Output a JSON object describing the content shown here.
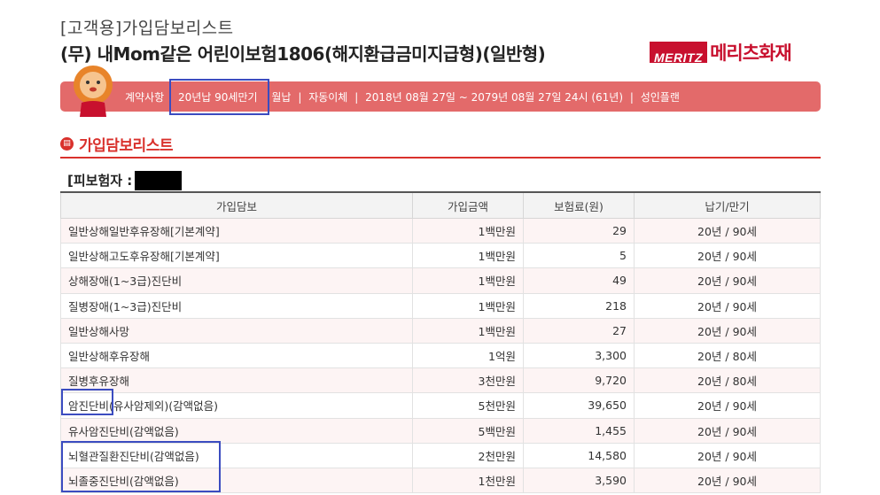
{
  "header": {
    "subtitle": "[고객용]가입담보리스트",
    "title": "(무) 내Mom같은 어린이보험1806(해지환급금미지급형)(일반형)"
  },
  "brand": {
    "mark": "MERITZ",
    "name": "메리츠화재",
    "color": "#c8102e"
  },
  "banner": {
    "label": "계약사항",
    "term": "20년납 90세만기",
    "payment": "월납",
    "transfer": "자동이체",
    "period": "2018년 08월 27일 ~ 2079년 08월 27일 24시 (61년)",
    "plan": "성인플랜",
    "separator": "|",
    "color": "#e36a6a"
  },
  "section": {
    "title": "가입담보리스트"
  },
  "insured": {
    "label": "[피보험자 :"
  },
  "table": {
    "headers": [
      "가입담보",
      "가입금액",
      "보험료(원)",
      "납기/만기"
    ],
    "rows": [
      {
        "name": "일반상해일반후유장해[기본계약]",
        "amount": "1백만원",
        "premium": "29",
        "term": "20년 / 90세"
      },
      {
        "name": "일반상해고도후유장해[기본계약]",
        "amount": "1백만원",
        "premium": "5",
        "term": "20년 / 90세"
      },
      {
        "name": "상해장애(1~3급)진단비",
        "amount": "1백만원",
        "premium": "49",
        "term": "20년 / 90세"
      },
      {
        "name": "질병장애(1~3급)진단비",
        "amount": "1백만원",
        "premium": "218",
        "term": "20년 / 90세"
      },
      {
        "name": "일반상해사망",
        "amount": "1백만원",
        "premium": "27",
        "term": "20년 / 90세"
      },
      {
        "name": "일반상해후유장해",
        "amount": "1억원",
        "premium": "3,300",
        "term": "20년 / 80세"
      },
      {
        "name": "질병후유장해",
        "amount": "3천만원",
        "premium": "9,720",
        "term": "20년 / 80세"
      },
      {
        "name": "암진단비(유사암제외)(감액없음)",
        "amount": "5천만원",
        "premium": "39,650",
        "term": "20년 / 90세"
      },
      {
        "name": "유사암진단비(감액없음)",
        "amount": "5백만원",
        "premium": "1,455",
        "term": "20년 / 90세"
      },
      {
        "name": "뇌혈관질환진단비(감액없음)",
        "amount": "2천만원",
        "premium": "14,580",
        "term": "20년 / 90세"
      },
      {
        "name": "뇌졸중진단비(감액없음)",
        "amount": "1천만원",
        "premium": "3,590",
        "term": "20년 / 90세"
      }
    ]
  },
  "highlight_color": "#3b4cc0"
}
